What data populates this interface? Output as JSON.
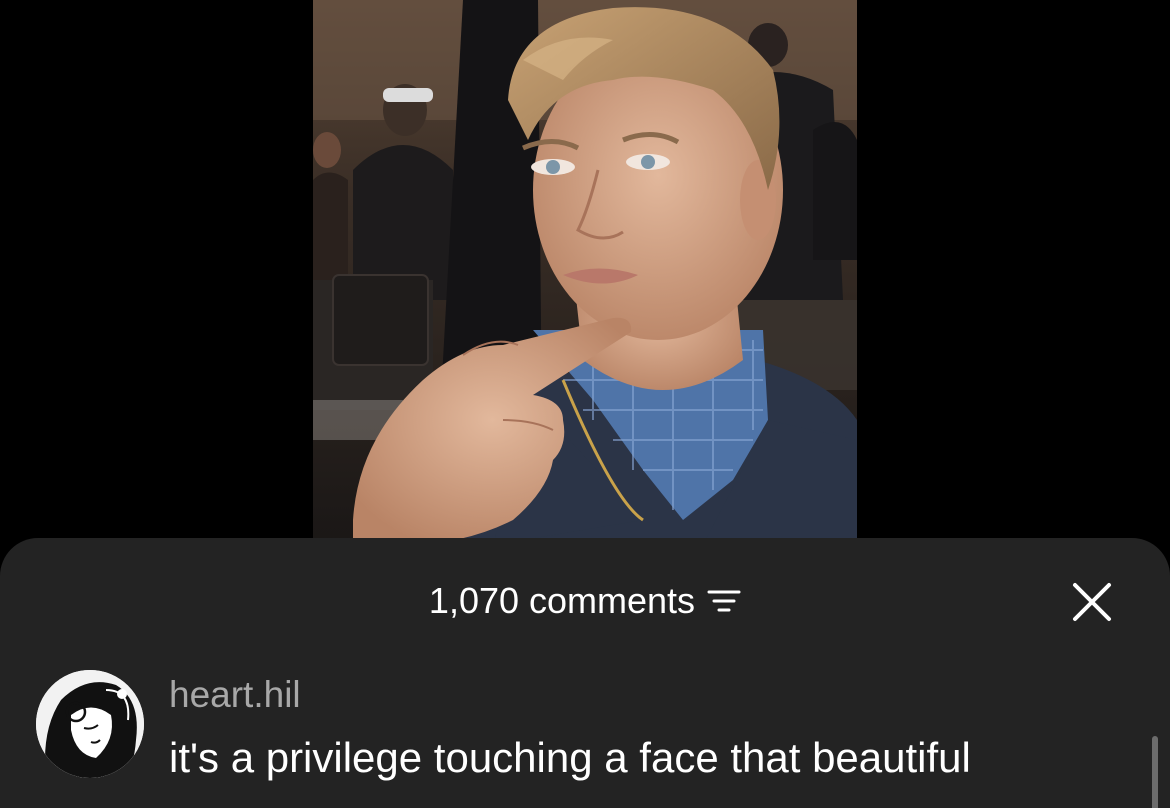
{
  "video": {
    "description_icon": "video-frame"
  },
  "comments_sheet": {
    "count_label": "1,070 comments",
    "sort_icon": "filter-lines-icon",
    "close_icon": "close-icon",
    "colors": {
      "sheet_background": "#232323",
      "text_primary": "#ffffff",
      "text_secondary": "#a8a8a8"
    }
  },
  "comments": [
    {
      "username": "heart.hil",
      "text": "it's a privilege touching a face that beautiful",
      "avatar_icon": "avatar-image"
    }
  ]
}
